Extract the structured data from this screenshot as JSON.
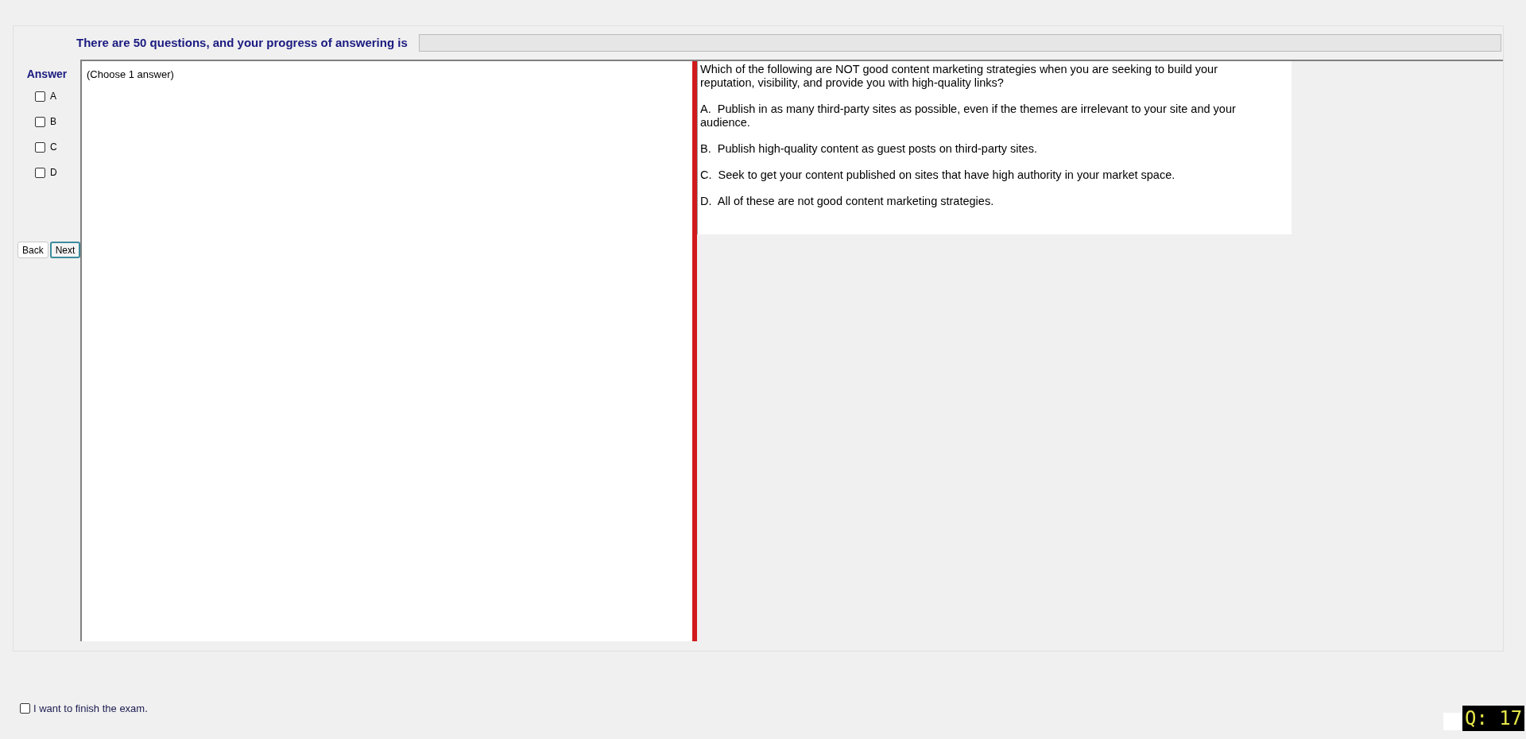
{
  "progress": {
    "label": "There are 50 questions, and your progress of answering is",
    "level": 0
  },
  "answer": {
    "title": "Answer",
    "options": [
      {
        "label": "A",
        "checked": false
      },
      {
        "label": "B",
        "checked": false
      },
      {
        "label": "C",
        "checked": false
      },
      {
        "label": "D",
        "checked": false
      }
    ]
  },
  "buttons": [
    {
      "label": "Back",
      "focused": false
    },
    {
      "label": "Next",
      "focused": true
    }
  ],
  "instruction": "(Choose 1 answer)",
  "question": {
    "text": "Which of the following are NOT good content marketing strategies when you are seeking to build your reputation, visibility, and provide you with high-quality links?",
    "choices": [
      "A.  Publish in as many third-party sites as possible, even if the themes are irrelevant to your site and your audience.",
      "B.  Publish high-quality content as guest posts on third-party sites.",
      "C.  Seek to get your content published on sites that have high authority in your market space.",
      "D.  All of these are not good content marketing strategies."
    ]
  },
  "finish": {
    "label": "I want to finish the exam.",
    "checked": false
  },
  "question_number": "Q: 17"
}
